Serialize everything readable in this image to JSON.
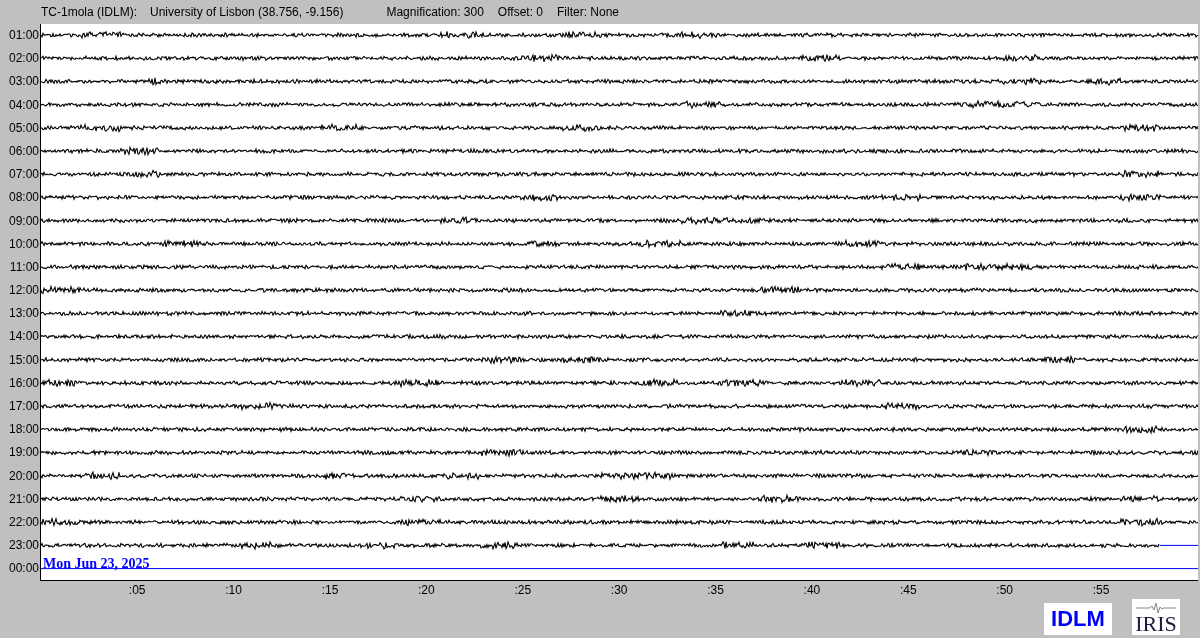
{
  "header": {
    "station": "TC-1mola (IDLM):",
    "location": "University of Lisbon (38.756, -9.156)",
    "magnification": "Magnification: 300",
    "offset": "Offset: 0",
    "filter": "Filter: None"
  },
  "rows": [
    {
      "time": "01:00",
      "kind": "trace"
    },
    {
      "time": "02:00",
      "kind": "trace"
    },
    {
      "time": "03:00",
      "kind": "trace"
    },
    {
      "time": "04:00",
      "kind": "trace"
    },
    {
      "time": "05:00",
      "kind": "trace"
    },
    {
      "time": "06:00",
      "kind": "trace"
    },
    {
      "time": "07:00",
      "kind": "trace"
    },
    {
      "time": "08:00",
      "kind": "trace"
    },
    {
      "time": "09:00",
      "kind": "trace"
    },
    {
      "time": "10:00",
      "kind": "trace"
    },
    {
      "time": "11:00",
      "kind": "trace"
    },
    {
      "time": "12:00",
      "kind": "trace"
    },
    {
      "time": "13:00",
      "kind": "trace"
    },
    {
      "time": "14:00",
      "kind": "trace"
    },
    {
      "time": "15:00",
      "kind": "trace"
    },
    {
      "time": "16:00",
      "kind": "trace"
    },
    {
      "time": "17:00",
      "kind": "trace"
    },
    {
      "time": "18:00",
      "kind": "trace"
    },
    {
      "time": "19:00",
      "kind": "trace"
    },
    {
      "time": "20:00",
      "kind": "trace"
    },
    {
      "time": "21:00",
      "kind": "trace"
    },
    {
      "time": "22:00",
      "kind": "trace"
    },
    {
      "time": "23:00",
      "kind": "partial",
      "level": 0.967
    },
    {
      "time": "00:00",
      "kind": "pending",
      "date": "Mon Jun 23, 2025"
    }
  ],
  "x_ticks": [
    ":05",
    ":10",
    ":15",
    ":20",
    ":25",
    ":30",
    ":35",
    ":40",
    ":45",
    ":50",
    ":55"
  ],
  "logos": {
    "station": "IDLM",
    "network": "IRIS"
  }
}
